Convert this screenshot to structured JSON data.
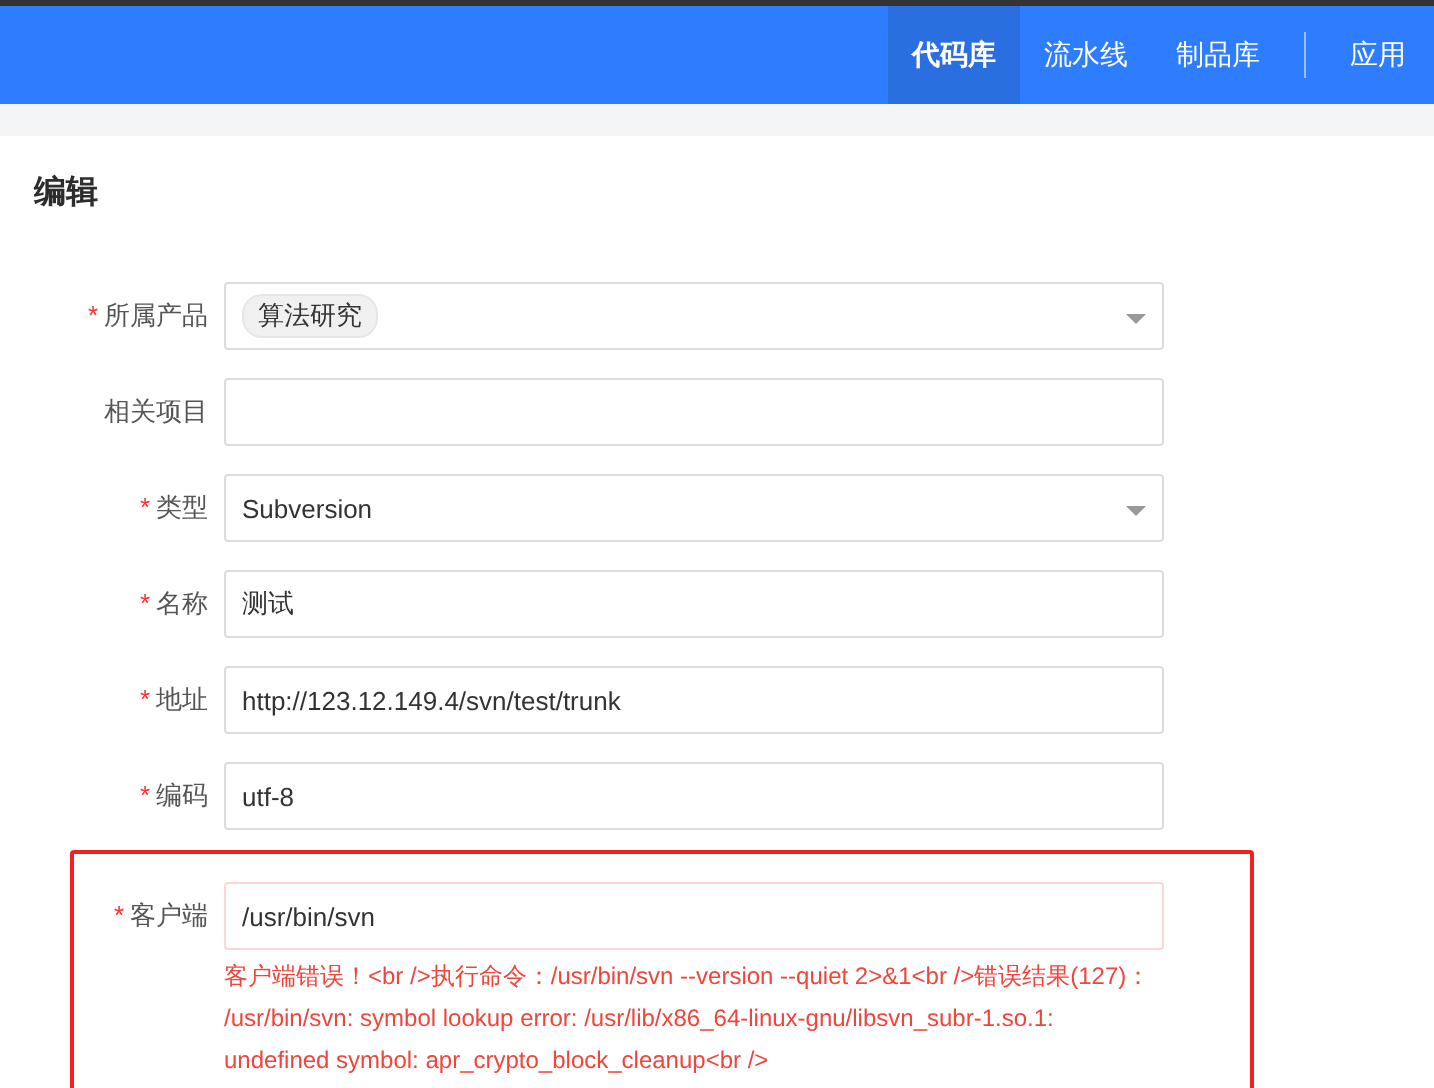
{
  "nav": {
    "items": [
      {
        "label": "代码库",
        "selected": true
      },
      {
        "label": "流水线",
        "selected": false
      },
      {
        "label": "制品库",
        "selected": false
      }
    ],
    "apps": "应用"
  },
  "page": {
    "title": "编辑"
  },
  "form": {
    "fields": [
      {
        "label": "所属产品",
        "required_mark": "*",
        "kind": "select",
        "tag": "算法研究"
      },
      {
        "label": "相关项目",
        "kind": "input"
      },
      {
        "label": "类型",
        "required_mark": "*",
        "kind": "select",
        "value": "Subversion"
      },
      {
        "label": "名称",
        "required_mark": "*",
        "kind": "input",
        "value": "测试"
      },
      {
        "label": "地址",
        "required_mark": "*",
        "kind": "input",
        "value": "http://123.12.149.4/svn/test/trunk"
      },
      {
        "label": "编码",
        "required_mark": "*",
        "kind": "input",
        "value": "utf-8"
      },
      {
        "label": "客户端",
        "required_mark": "*",
        "kind": "input",
        "value": "/usr/bin/svn",
        "error": "客户端错误！<br />执行命令：/usr/bin/svn --version --quiet 2>&1<br />错误结果(127)：  /usr/bin/svn: symbol lookup error: /usr/lib/x86_64-linux-gnu/libsvn_subr-1.so.1: undefined symbol: apr_crypto_block_cleanup<br />",
        "highlighted": true
      }
    ]
  }
}
